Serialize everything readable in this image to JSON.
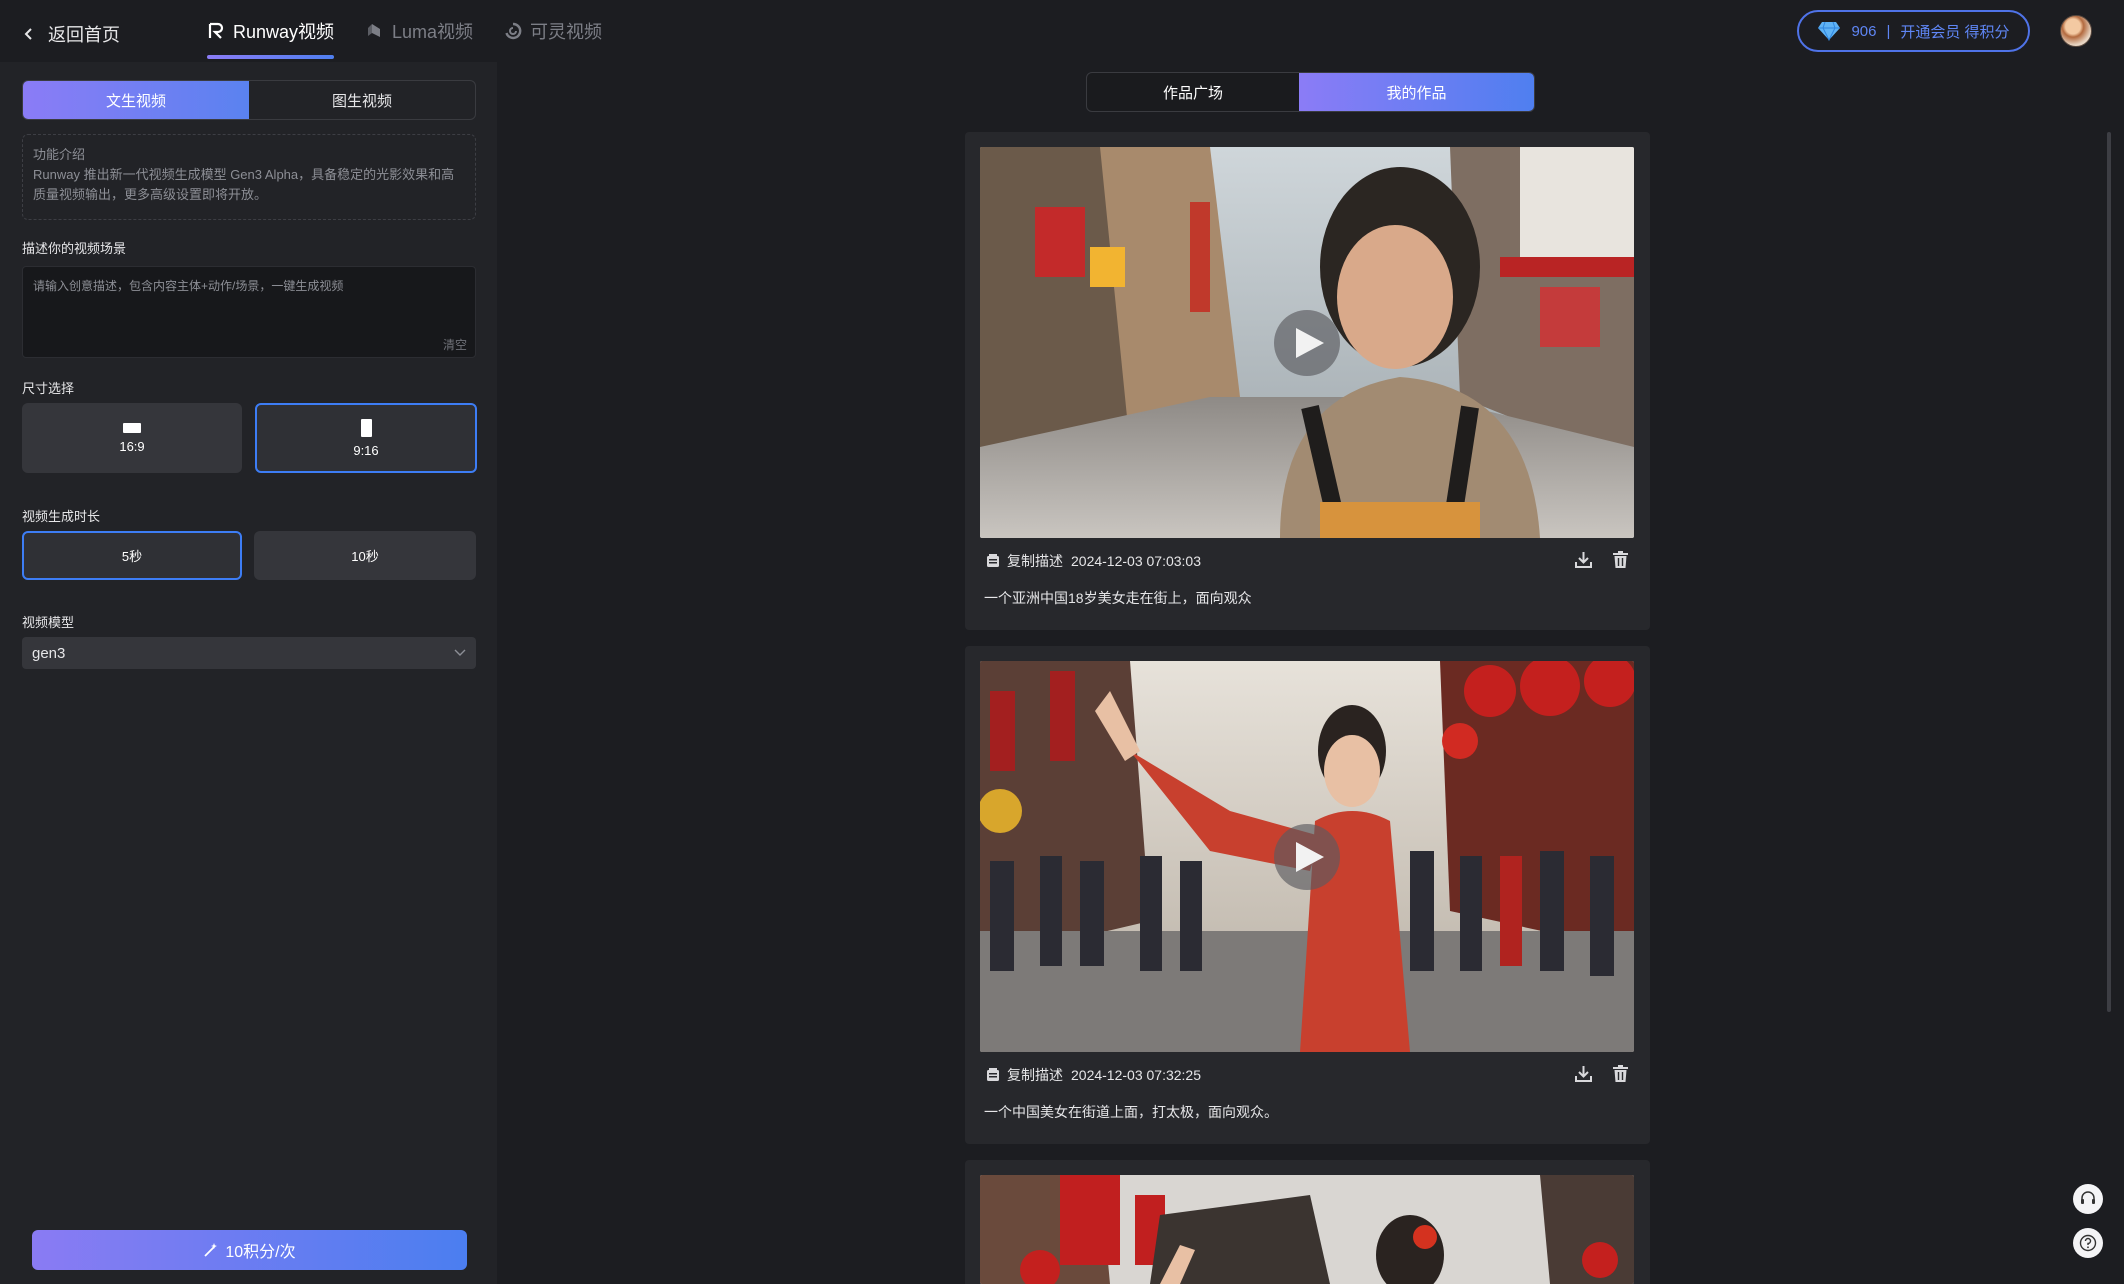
{
  "header": {
    "back_label": "返回首页",
    "tabs": [
      {
        "label": "Runway视频",
        "icon": "runway-logo-icon",
        "active": true
      },
      {
        "label": "Luma视频",
        "icon": "luma-logo-icon",
        "active": false
      },
      {
        "label": "可灵视频",
        "icon": "kling-logo-icon",
        "active": false
      }
    ],
    "points": "906",
    "points_divider": "|",
    "points_action": "开通会员 得积分"
  },
  "sidebar": {
    "modes": [
      "文生视频",
      "图生视频"
    ],
    "active_mode": "文生视频",
    "intro_title": "功能介绍",
    "intro_text": "Runway 推出新一代视频生成模型 Gen3 Alpha，具备稳定的光影效果和高质量视频输出，更多高级设置即将开放。",
    "prompt_label": "描述你的视频场景",
    "prompt_placeholder": "请输入创意描述，包含内容主体+动作/场景，一键生成视频",
    "prompt_value": "",
    "clear_label": "清空",
    "size_label": "尺寸选择",
    "sizes": [
      {
        "label": "16:9",
        "selected": false
      },
      {
        "label": "9:16",
        "selected": true
      }
    ],
    "duration_label": "视频生成时长",
    "durations": [
      {
        "label": "5秒",
        "selected": true
      },
      {
        "label": "10秒",
        "selected": false
      }
    ],
    "model_label": "视频模型",
    "model_value": "gen3",
    "generate_label": "10积分/次"
  },
  "main": {
    "segments": [
      "作品广场",
      "我的作品"
    ],
    "active_segment": "我的作品",
    "works": [
      {
        "copy_label": "复制描述",
        "timestamp": "2024-12-03 07:03:03",
        "description": "一个亚洲中国18岁美女走在街上，面向观众"
      },
      {
        "copy_label": "复制描述",
        "timestamp": "2024-12-03 07:32:25",
        "description": "一个中国美女在街道上面，打太极，面向观众。"
      }
    ]
  },
  "colors": {
    "accent_start": "#8b7cf6",
    "accent_end": "#4f7ff0",
    "selected_border": "#3d7df5",
    "points_blue": "#5f86f5"
  }
}
